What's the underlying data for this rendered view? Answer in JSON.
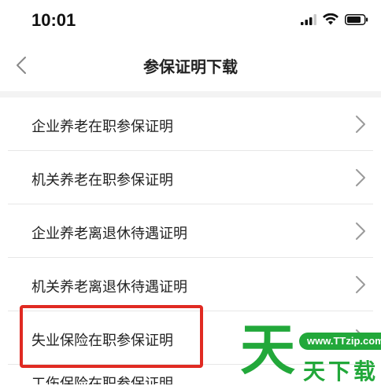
{
  "status_bar": {
    "time": "10:01"
  },
  "nav": {
    "title": "参保证明下载"
  },
  "list": {
    "items": [
      {
        "label": "企业养老在职参保证明"
      },
      {
        "label": "机关养老在职参保证明"
      },
      {
        "label": "企业养老离退休待遇证明"
      },
      {
        "label": "机关养老离退休待遇证明"
      },
      {
        "label": "失业保险在职参保证明"
      }
    ],
    "partial_item": "工伤保险在职参保证明"
  },
  "watermark": {
    "big_char": "天",
    "url": "www.TTzip.com",
    "small_text": "天下载"
  },
  "colors": {
    "highlight": "#e02a22",
    "watermark": "#22a83a"
  }
}
